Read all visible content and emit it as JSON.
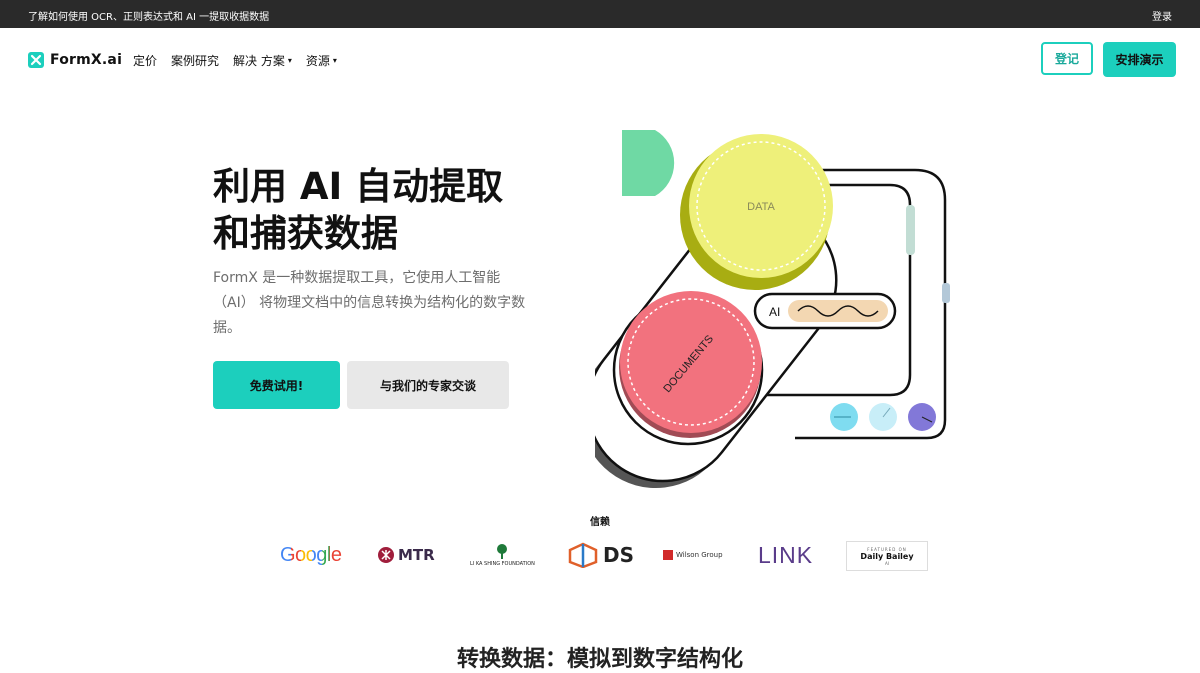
{
  "topbar": {
    "announcement": "了解如何使用 OCR、正则表达式和 AI 一提取收据数据",
    "login": "登录"
  },
  "nav": {
    "logo_text": "FormX.ai",
    "items": [
      {
        "label": "定价",
        "has_dropdown": false
      },
      {
        "label": "案例研究",
        "has_dropdown": false
      },
      {
        "label": "解决 方案",
        "has_dropdown": true
      },
      {
        "label": "资源",
        "has_dropdown": true
      }
    ],
    "signup_label": "登记",
    "demo_label": "安排演示"
  },
  "hero": {
    "title_line1": "利用 AI 自动提取",
    "title_line2": "和捕获数据",
    "description": "FormX 是一种数据提取工具，它使用人工智能（AI） 将物理文档中的信息转换为结构化的数字数据。",
    "primary_cta": "免费试用!",
    "secondary_cta": "与我们的专家交谈"
  },
  "illustration": {
    "data_label": "DATA",
    "ai_label": "AI",
    "documents_label": "DOCUMENTS"
  },
  "trust": {
    "label": "信赖",
    "logos": {
      "google": "Google",
      "mtr": "MTR",
      "lks": "LI KA SHING FOUNDATION",
      "ds": "DS",
      "wilson": "Wilson Group",
      "link": "LINK",
      "daily_bailey_featured": "FEATURED ON",
      "daily_bailey_name": "Daily Bailey",
      "daily_bailey_ai": "AI"
    }
  },
  "section": {
    "title": "转换数据：模拟到数字结构化"
  },
  "colors": {
    "accent": "#1ccfbd",
    "topbar": "#2a2a2a",
    "data_circle": "#eef07a",
    "documents_circle": "#f2727e",
    "green_shape": "#6fd9a4"
  }
}
